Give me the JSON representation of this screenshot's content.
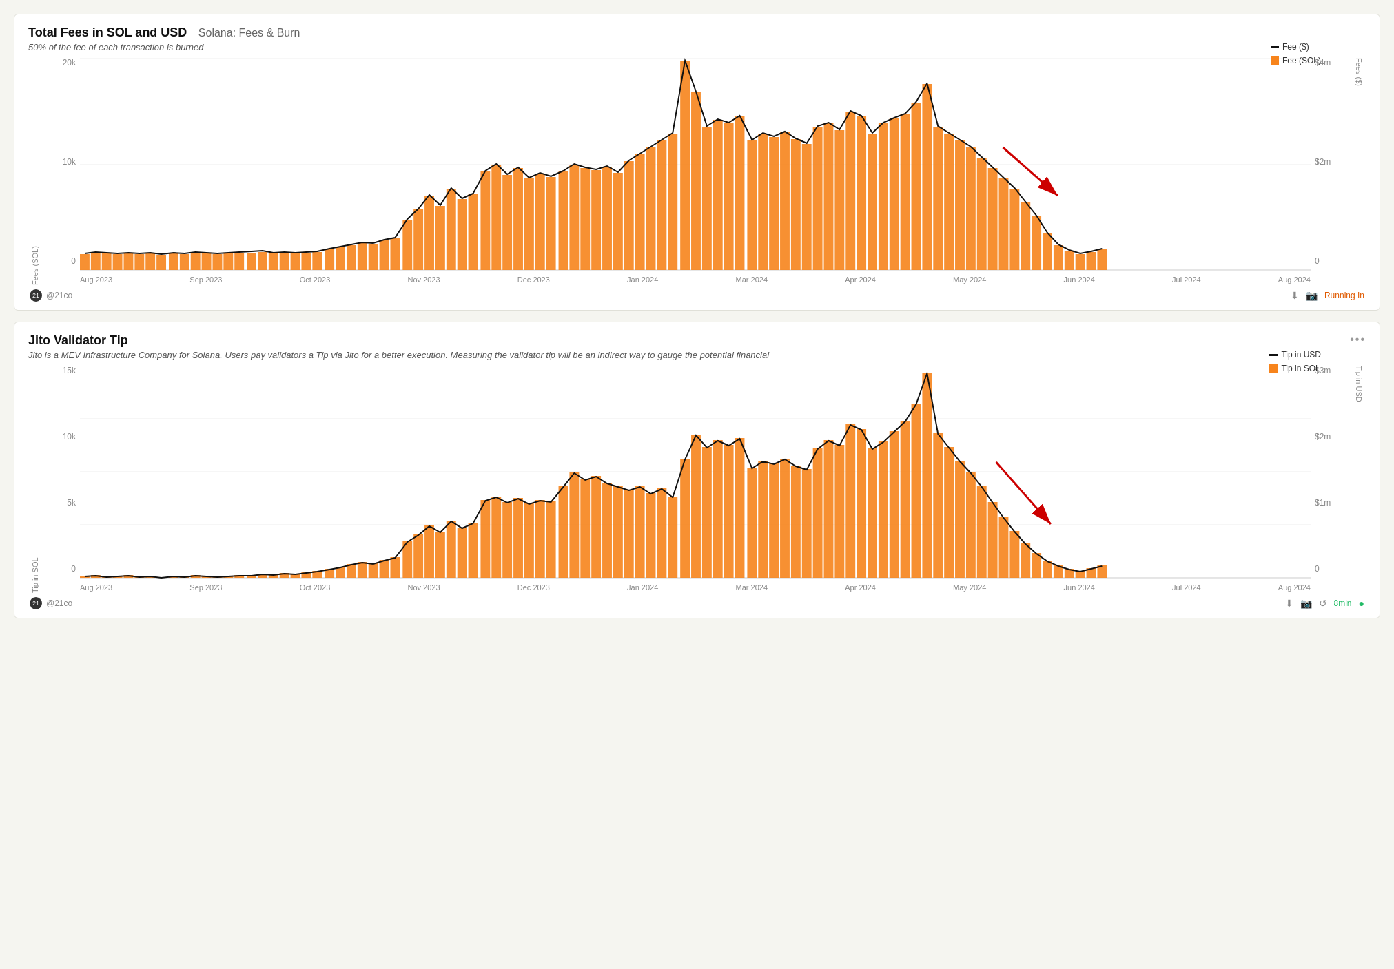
{
  "chart1": {
    "title": "Total Fees in SOL and USD",
    "subtitle": "Solana: Fees & Burn",
    "description": "50% of the fee of each transaction is burned",
    "y_left_labels": [
      "20k",
      "10k",
      "0"
    ],
    "y_right_labels": [
      "$4m",
      "$2m",
      "0"
    ],
    "y_left_axis_label": "Fees (SOL)",
    "y_right_axis_label": "Fees ($)",
    "x_labels": [
      "Aug 2023",
      "Sep 2023",
      "Oct 2023",
      "Nov 2023",
      "Dec 2023",
      "Jan 2024",
      "Mar 2024",
      "Apr 2024",
      "May 2024",
      "Jun 2024",
      "Jul 2024",
      "Aug 2024"
    ],
    "legend": [
      {
        "label": "Fee ($)",
        "type": "line"
      },
      {
        "label": "Fee (SOL)",
        "type": "bar"
      }
    ],
    "footer_user": "@21co",
    "footer_status": "Running In",
    "footer_icons": [
      "download-icon",
      "camera-icon"
    ]
  },
  "chart2": {
    "title": "Jito Validator Tip",
    "description": "Jito is a MEV Infrastructure Company for Solana. Users pay validators a Tip via Jito for a better execution. Measuring the validator tip will be an indirect way to gauge the potential financial",
    "y_left_labels": [
      "15k",
      "10k",
      "5k",
      "0"
    ],
    "y_right_labels": [
      "$3m",
      "$2m",
      "$1m",
      "0"
    ],
    "y_left_axis_label": "Tip in SOL",
    "y_right_axis_label": "Tip in USD",
    "x_labels": [
      "Aug 2023",
      "Sep 2023",
      "Oct 2023",
      "Nov 2023",
      "Dec 2023",
      "Jan 2024",
      "Mar 2024",
      "Apr 2024",
      "May 2024",
      "Jun 2024",
      "Jul 2024",
      "Aug 2024"
    ],
    "legend": [
      {
        "label": "Tip in USD",
        "type": "line"
      },
      {
        "label": "Tip in SOL",
        "type": "bar"
      }
    ],
    "footer_user": "@21co",
    "footer_status": "8min",
    "footer_icons": [
      "download-icon",
      "camera-icon",
      "refresh-icon"
    ]
  },
  "colors": {
    "orange": "#f7841c",
    "black_line": "#111111",
    "red_arrow": "#cc0000",
    "accent_green": "#22bb66",
    "accent_orange_text": "#e05a00"
  }
}
